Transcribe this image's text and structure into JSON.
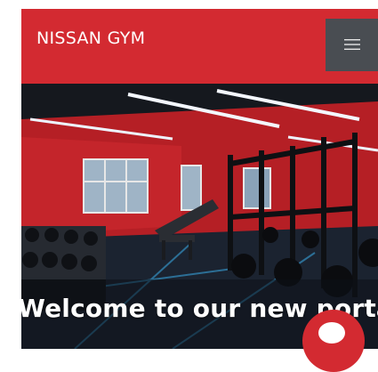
{
  "header": {
    "brand": "NISSAN GYM",
    "menu_icon": "hamburger-menu-icon"
  },
  "hero": {
    "image": "gym-interior-photo",
    "heading": "Welcome to our new porta"
  },
  "chat": {
    "icon": "chat-bubble-icon"
  },
  "colors": {
    "brand_red": "#d32a31",
    "menu_button": "#494d52"
  }
}
